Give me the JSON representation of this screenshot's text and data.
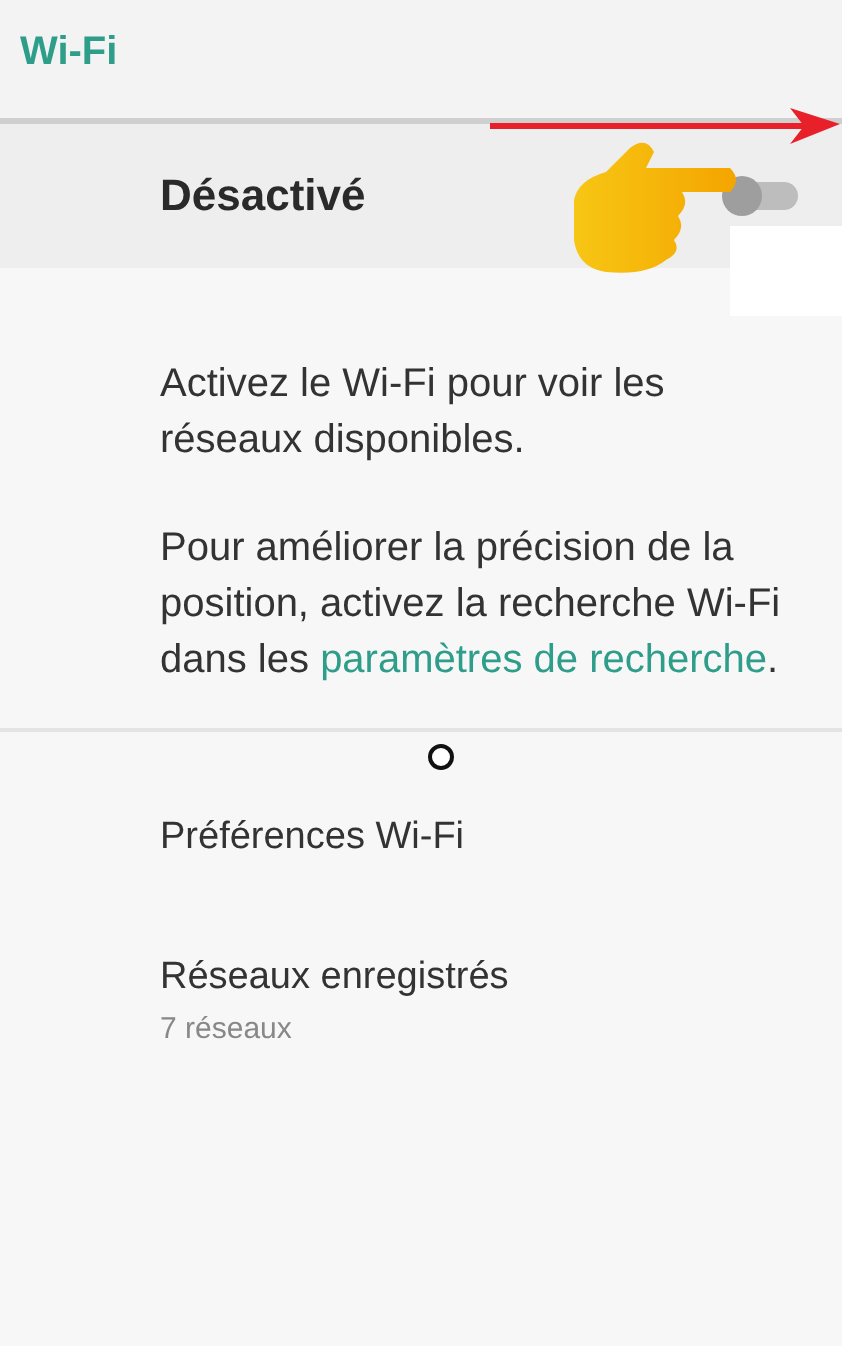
{
  "header": {
    "title": "Wi-Fi"
  },
  "master_switch": {
    "label": "Désactivé",
    "on": false
  },
  "message": {
    "text": "Activez le Wi-Fi pour voir les réseaux disponibles."
  },
  "hint": {
    "text_before": "Pour améliorer la précision de la position, activez la recherche Wi-Fi dans les ",
    "link": "paramètres de recherche",
    "text_after": "."
  },
  "items": [
    {
      "title": "Préférences Wi-Fi"
    },
    {
      "title": "Réseaux enregistrés",
      "subtitle": "7 réseaux"
    }
  ]
}
